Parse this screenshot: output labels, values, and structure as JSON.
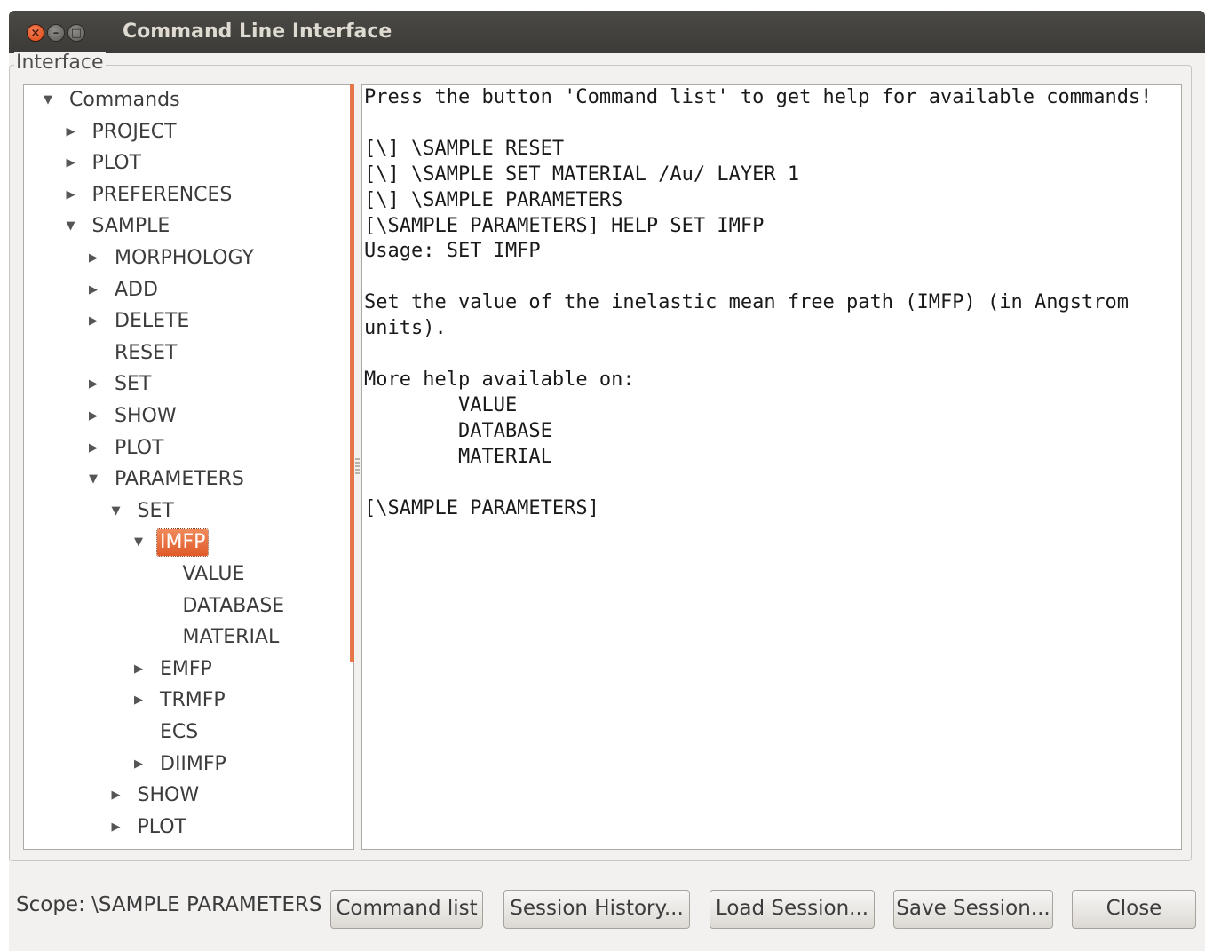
{
  "window": {
    "title": "Command Line Interface",
    "controls": {
      "close": "×",
      "minimize": "–",
      "maximize": "□"
    }
  },
  "group_title": "Interface",
  "tree": [
    {
      "label": "Commands",
      "state": "expanded"
    },
    {
      "label": "PROJECT",
      "state": "collapsed"
    },
    {
      "label": "PLOT",
      "state": "collapsed"
    },
    {
      "label": "PREFERENCES",
      "state": "collapsed"
    },
    {
      "label": "SAMPLE",
      "state": "expanded"
    },
    {
      "label": "MORPHOLOGY",
      "state": "collapsed"
    },
    {
      "label": "ADD",
      "state": "collapsed"
    },
    {
      "label": "DELETE",
      "state": "collapsed"
    },
    {
      "label": "RESET",
      "state": "leaf"
    },
    {
      "label": "SET",
      "state": "collapsed"
    },
    {
      "label": "SHOW",
      "state": "collapsed"
    },
    {
      "label": "PLOT",
      "state": "collapsed"
    },
    {
      "label": "PARAMETERS",
      "state": "expanded"
    },
    {
      "label": "SET",
      "state": "expanded"
    },
    {
      "label": "IMFP",
      "state": "expanded",
      "selected": true
    },
    {
      "label": "VALUE",
      "state": "leaf"
    },
    {
      "label": "DATABASE",
      "state": "leaf"
    },
    {
      "label": "MATERIAL",
      "state": "leaf"
    },
    {
      "label": "EMFP",
      "state": "collapsed"
    },
    {
      "label": "TRMFP",
      "state": "collapsed"
    },
    {
      "label": "ECS",
      "state": "leaf"
    },
    {
      "label": "DIIMFP",
      "state": "collapsed"
    },
    {
      "label": "SHOW",
      "state": "collapsed"
    },
    {
      "label": "PLOT",
      "state": "collapsed"
    }
  ],
  "output": {
    "text": "Press the button 'Command list' to get help for available commands!\n\n[\\] \\SAMPLE RESET\n[\\] \\SAMPLE SET MATERIAL /Au/ LAYER 1\n[\\] \\SAMPLE PARAMETERS\n[\\SAMPLE PARAMETERS] HELP SET IMFP\nUsage: SET IMFP\n\nSet the value of the inelastic mean free path (IMFP) (in Angstrom\nunits).\n\nMore help available on:\n        VALUE\n        DATABASE\n        MATERIAL\n\n[\\SAMPLE PARAMETERS]"
  },
  "footer": {
    "scope": "Scope: \\SAMPLE PARAMETERS",
    "buttons": {
      "command_list": "Command list",
      "session_history": "Session History...",
      "load_session": "Load Session...",
      "save_session": "Save Session...",
      "close": "Close"
    }
  },
  "colors": {
    "selection": "#e05a28",
    "titlebar": "#3c3b37",
    "close_button": "#dd4814"
  },
  "icons": {
    "expanded": "triangle-down-icon",
    "collapsed": "triangle-right-icon"
  }
}
